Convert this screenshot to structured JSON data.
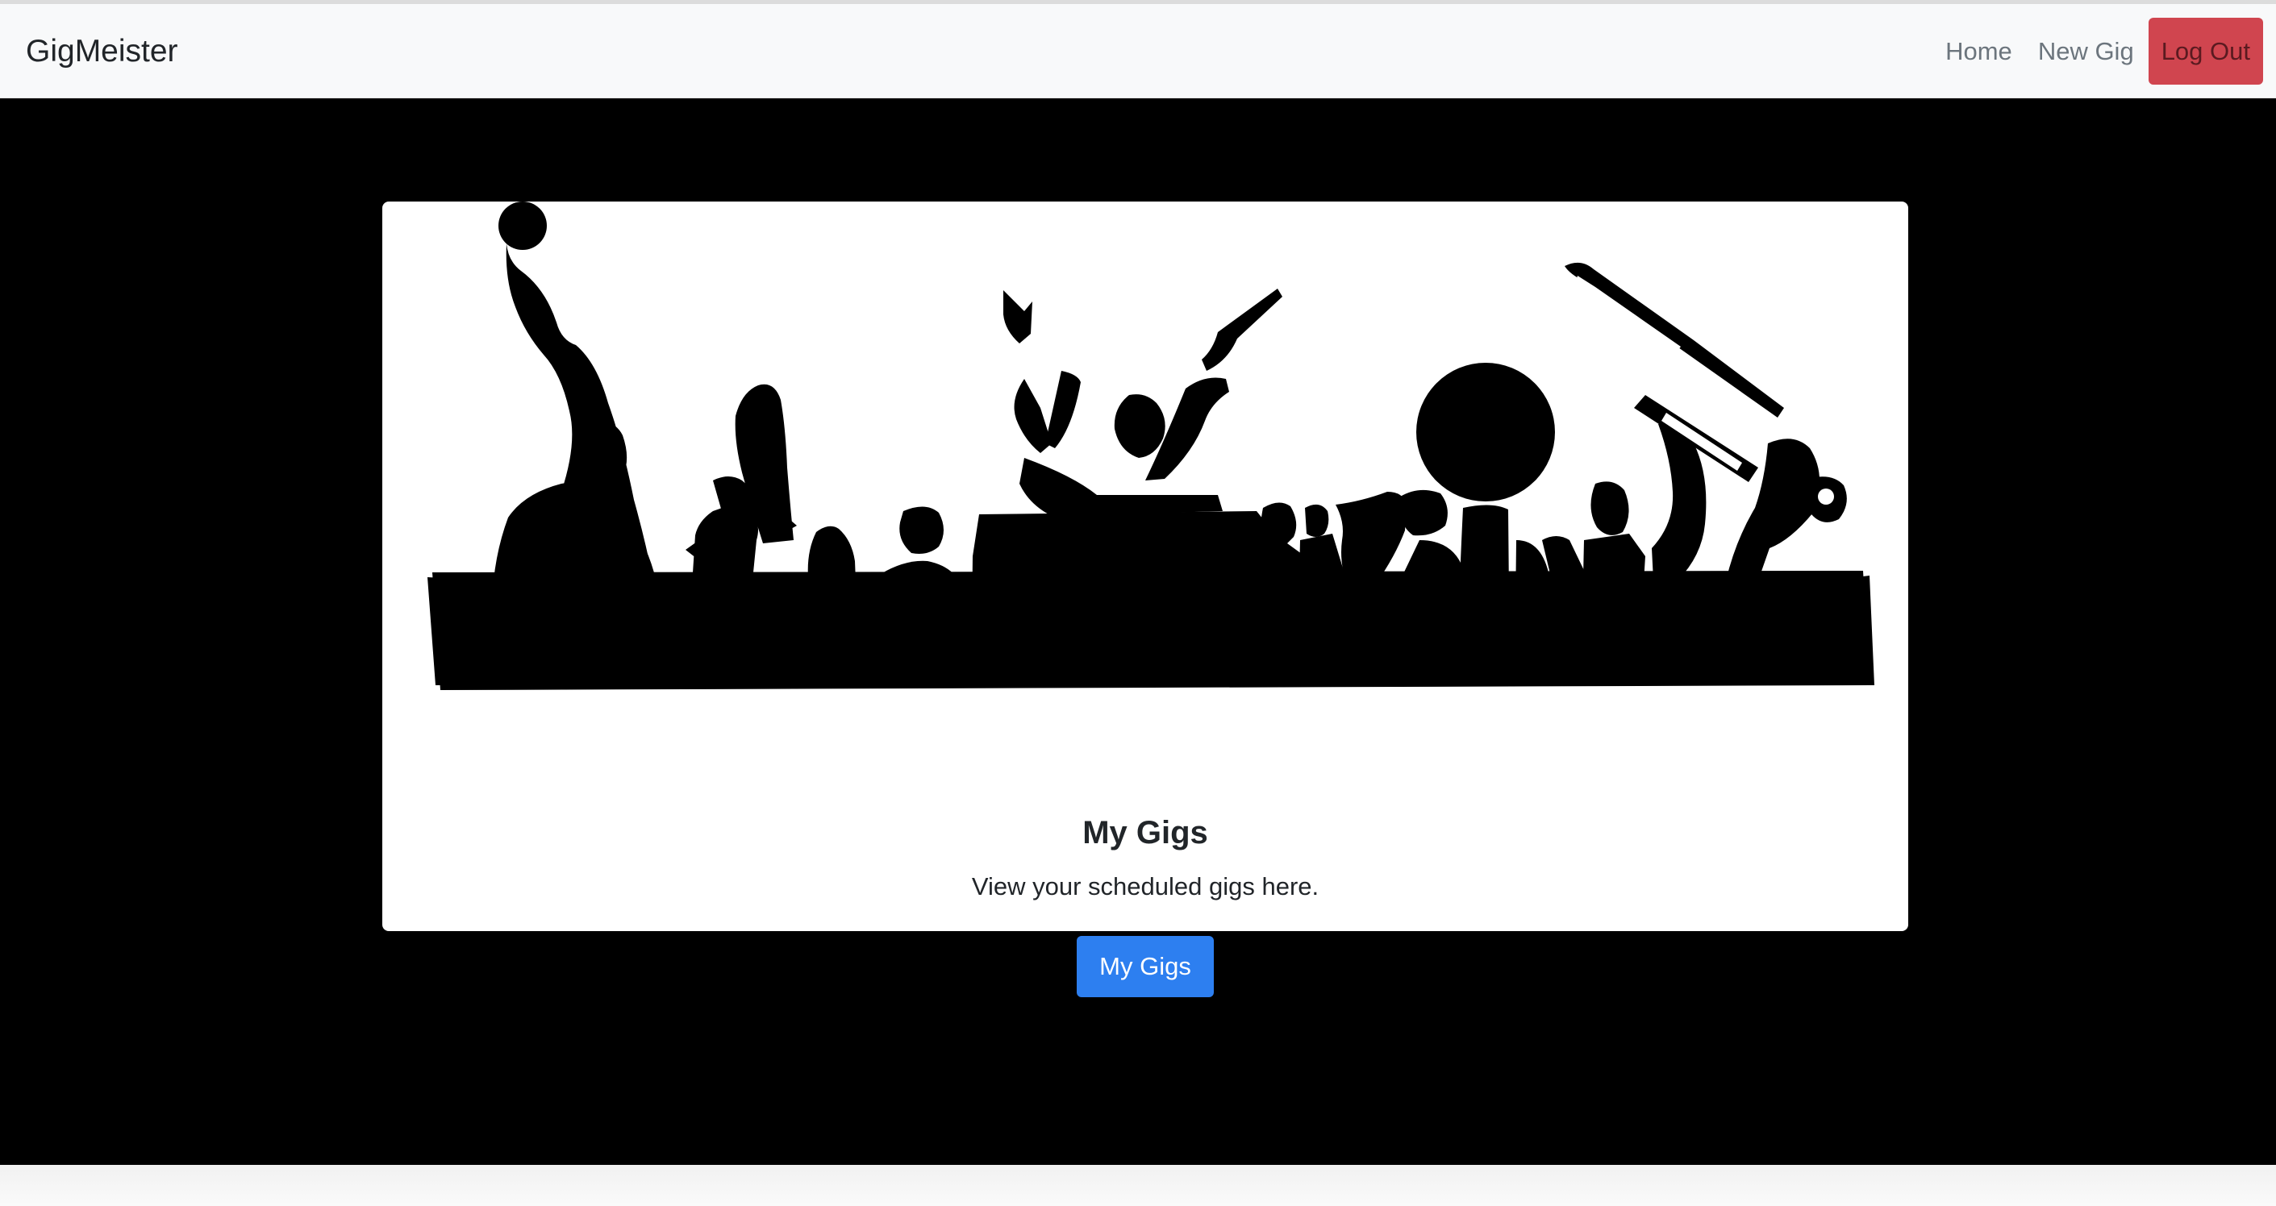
{
  "app": {
    "brand": "GigMeister"
  },
  "nav": {
    "items": [
      {
        "label": "Home"
      },
      {
        "label": "New Gig"
      }
    ],
    "logout_label": "Log Out"
  },
  "card": {
    "image_icon": "orchestra-silhouette-illustration",
    "title": "My Gigs",
    "text": "View your scheduled gigs here.",
    "button_label": "My Gigs"
  },
  "colors": {
    "hero_background": "#000000",
    "navbar_background": "#f8f9fa",
    "primary": "#2d7ff0",
    "danger": "#d0454f"
  }
}
